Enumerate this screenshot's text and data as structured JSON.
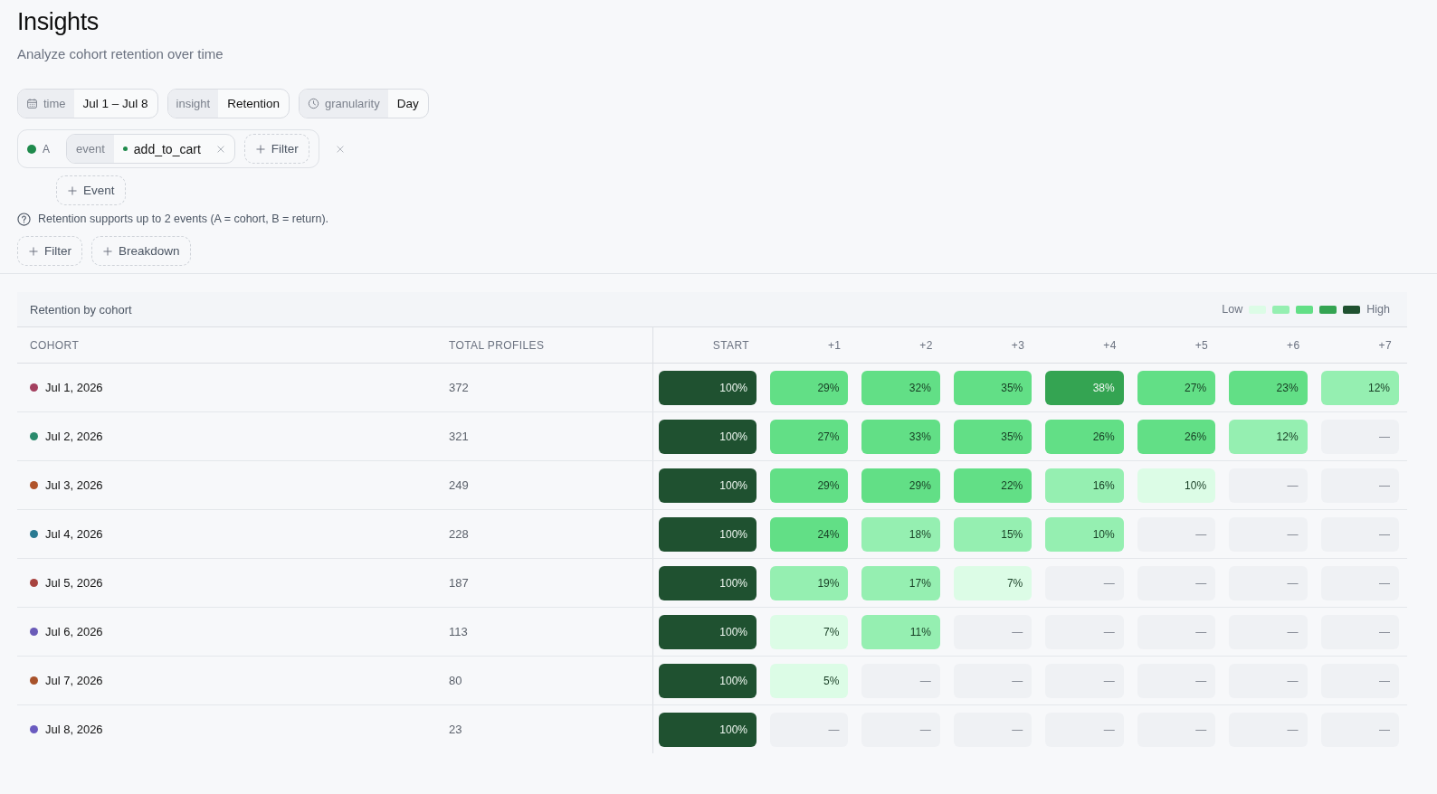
{
  "header": {
    "title": "Insights",
    "subtitle": "Analyze cohort retention over time"
  },
  "controls": [
    {
      "kind": "range",
      "label": "time",
      "value": "Jul 1 – Jul 8"
    },
    {
      "kind": "select",
      "label": "insight",
      "value": "Retention"
    },
    {
      "kind": "interval",
      "label": "granularity",
      "value": "Day"
    }
  ],
  "events": [
    {
      "letter": "A",
      "color": "#1f8a4c",
      "label": "event",
      "name": "add_to_cart",
      "filter": "Filter"
    }
  ],
  "add_event": "Event",
  "hint": "Retention supports up to 2 events (A = cohort, B = return).",
  "actions": [
    "Filter",
    "Breakdown"
  ],
  "table": {
    "title": "Retention by cohort",
    "legend": {
      "low": "Low",
      "high": "High",
      "swatches": [
        {
          "color": "#dcfce6"
        },
        {
          "color": "#95efb1"
        },
        {
          "color": "#62df86"
        },
        {
          "color": "#34a452"
        },
        {
          "color": "#1f5130"
        }
      ]
    },
    "columns": [
      "COHORT",
      "TOTAL PROFILES",
      "START",
      "+1",
      "+2",
      "+3",
      "+4",
      "+5",
      "+6",
      "+7"
    ],
    "rows": [
      {
        "cells": [
          {
            "kind": "cohort",
            "text": "Jul 1, 2026",
            "color": "#a3405f"
          },
          {
            "kind": "count",
            "text": "372"
          },
          {
            "kind": "value",
            "text": "100%",
            "color": "#1f5130"
          },
          {
            "kind": "value",
            "text": "29%",
            "color": "#62df86"
          },
          {
            "kind": "value",
            "text": "32%",
            "color": "#62df86"
          },
          {
            "kind": "value",
            "text": "35%",
            "color": "#62df86"
          },
          {
            "kind": "value",
            "text": "38%",
            "color": "#34a452"
          },
          {
            "kind": "value",
            "text": "27%",
            "color": "#62df86"
          },
          {
            "kind": "value",
            "text": "23%",
            "color": "#62df86"
          },
          {
            "kind": "value",
            "text": "12%",
            "color": "#95efb1"
          }
        ]
      },
      {
        "cells": [
          {
            "kind": "cohort",
            "text": "Jul 2, 2026",
            "color": "#2a8a6c"
          },
          {
            "kind": "count",
            "text": "321"
          },
          {
            "kind": "value",
            "text": "100%",
            "color": "#1f5130"
          },
          {
            "kind": "value",
            "text": "27%",
            "color": "#62df86"
          },
          {
            "kind": "value",
            "text": "33%",
            "color": "#62df86"
          },
          {
            "kind": "value",
            "text": "35%",
            "color": "#62df86"
          },
          {
            "kind": "value",
            "text": "26%",
            "color": "#62df86"
          },
          {
            "kind": "value",
            "text": "26%",
            "color": "#62df86"
          },
          {
            "kind": "value",
            "text": "12%",
            "color": "#95efb1"
          },
          {
            "kind": "empty",
            "text": "—"
          }
        ]
      },
      {
        "cells": [
          {
            "kind": "cohort",
            "text": "Jul 3, 2026",
            "color": "#b0532a"
          },
          {
            "kind": "count",
            "text": "249"
          },
          {
            "kind": "value",
            "text": "100%",
            "color": "#1f5130"
          },
          {
            "kind": "value",
            "text": "29%",
            "color": "#62df86"
          },
          {
            "kind": "value",
            "text": "29%",
            "color": "#62df86"
          },
          {
            "kind": "value",
            "text": "22%",
            "color": "#62df86"
          },
          {
            "kind": "value",
            "text": "16%",
            "color": "#95efb1"
          },
          {
            "kind": "value",
            "text": "10%",
            "color": "#dcfce6"
          },
          {
            "kind": "empty",
            "text": "—"
          },
          {
            "kind": "empty",
            "text": "—"
          }
        ]
      },
      {
        "cells": [
          {
            "kind": "cohort",
            "text": "Jul 4, 2026",
            "color": "#2a7a92"
          },
          {
            "kind": "count",
            "text": "228"
          },
          {
            "kind": "value",
            "text": "100%",
            "color": "#1f5130"
          },
          {
            "kind": "value",
            "text": "24%",
            "color": "#62df86"
          },
          {
            "kind": "value",
            "text": "18%",
            "color": "#95efb1"
          },
          {
            "kind": "value",
            "text": "15%",
            "color": "#95efb1"
          },
          {
            "kind": "value",
            "text": "10%",
            "color": "#95efb1"
          },
          {
            "kind": "empty",
            "text": "—"
          },
          {
            "kind": "empty",
            "text": "—"
          },
          {
            "kind": "empty",
            "text": "—"
          }
        ]
      },
      {
        "cells": [
          {
            "kind": "cohort",
            "text": "Jul 5, 2026",
            "color": "#a8433f"
          },
          {
            "kind": "count",
            "text": "187"
          },
          {
            "kind": "value",
            "text": "100%",
            "color": "#1f5130"
          },
          {
            "kind": "value",
            "text": "19%",
            "color": "#95efb1"
          },
          {
            "kind": "value",
            "text": "17%",
            "color": "#95efb1"
          },
          {
            "kind": "value",
            "text": "7%",
            "color": "#dcfce6"
          },
          {
            "kind": "empty",
            "text": "—"
          },
          {
            "kind": "empty",
            "text": "—"
          },
          {
            "kind": "empty",
            "text": "—"
          },
          {
            "kind": "empty",
            "text": "—"
          }
        ]
      },
      {
        "cells": [
          {
            "kind": "cohort",
            "text": "Jul 6, 2026",
            "color": "#6a5bb8"
          },
          {
            "kind": "count",
            "text": "113"
          },
          {
            "kind": "value",
            "text": "100%",
            "color": "#1f5130"
          },
          {
            "kind": "value",
            "text": "7%",
            "color": "#dcfce6"
          },
          {
            "kind": "value",
            "text": "11%",
            "color": "#95efb1"
          },
          {
            "kind": "empty",
            "text": "—"
          },
          {
            "kind": "empty",
            "text": "—"
          },
          {
            "kind": "empty",
            "text": "—"
          },
          {
            "kind": "empty",
            "text": "—"
          },
          {
            "kind": "empty",
            "text": "—"
          }
        ]
      },
      {
        "cells": [
          {
            "kind": "cohort",
            "text": "Jul 7, 2026",
            "color": "#a8522a"
          },
          {
            "kind": "count",
            "text": "80"
          },
          {
            "kind": "value",
            "text": "100%",
            "color": "#1f5130"
          },
          {
            "kind": "value",
            "text": "5%",
            "color": "#dcfce6"
          },
          {
            "kind": "empty",
            "text": "—"
          },
          {
            "kind": "empty",
            "text": "—"
          },
          {
            "kind": "empty",
            "text": "—"
          },
          {
            "kind": "empty",
            "text": "—"
          },
          {
            "kind": "empty",
            "text": "—"
          },
          {
            "kind": "empty",
            "text": "—"
          }
        ]
      },
      {
        "cells": [
          {
            "kind": "cohort",
            "text": "Jul 8, 2026",
            "color": "#6a5bc0"
          },
          {
            "kind": "count",
            "text": "23"
          },
          {
            "kind": "value",
            "text": "100%",
            "color": "#1f5130"
          },
          {
            "kind": "empty",
            "text": "—"
          },
          {
            "kind": "empty",
            "text": "—"
          },
          {
            "kind": "empty",
            "text": "—"
          },
          {
            "kind": "empty",
            "text": "—"
          },
          {
            "kind": "empty",
            "text": "—"
          },
          {
            "kind": "empty",
            "text": "—"
          },
          {
            "kind": "empty",
            "text": "—"
          }
        ]
      }
    ]
  }
}
